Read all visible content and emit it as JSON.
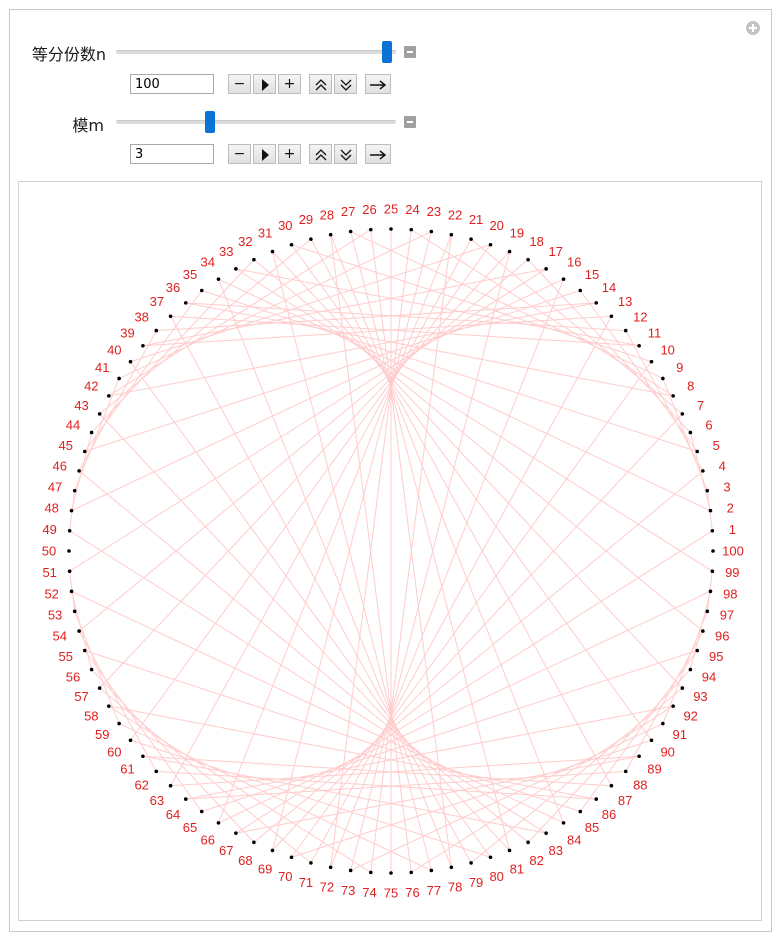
{
  "controls": {
    "n": {
      "label": "等分份数n",
      "value": "100",
      "slider_fraction": 0.985
    },
    "m": {
      "label": "模m",
      "value": "3",
      "slider_fraction": 0.33
    },
    "button_glyphs": {
      "decrement": "−",
      "increment": "+",
      "play": "play-icon",
      "faster": "double-chevron-up-icon",
      "slower": "double-chevron-down-icon",
      "direction": "arrow-right-icon"
    }
  },
  "chart_data": {
    "type": "cardioid-multiplication-circle",
    "n": 100,
    "multiplier": 3,
    "point_labels": [
      "1",
      "2",
      "3",
      "4",
      "5",
      "6",
      "7",
      "8",
      "9",
      "10",
      "11",
      "12",
      "13",
      "14",
      "15",
      "16",
      "17",
      "18",
      "19",
      "20",
      "21",
      "22",
      "23",
      "24",
      "25",
      "26",
      "27",
      "28",
      "29",
      "30",
      "31",
      "32",
      "33",
      "34",
      "35",
      "36",
      "37",
      "38",
      "39",
      "40",
      "41",
      "42",
      "43",
      "44",
      "45",
      "46",
      "47",
      "48",
      "49",
      "50",
      "51",
      "52",
      "53",
      "54",
      "55",
      "56",
      "57",
      "58",
      "59",
      "60",
      "61",
      "62",
      "63",
      "64",
      "65",
      "66",
      "67",
      "68",
      "69",
      "70",
      "71",
      "72",
      "73",
      "74",
      "75",
      "76",
      "77",
      "78",
      "79",
      "80",
      "81",
      "82",
      "83",
      "84",
      "85",
      "86",
      "87",
      "88",
      "89",
      "90",
      "91",
      "92",
      "93",
      "94",
      "95",
      "96",
      "97",
      "98",
      "99",
      "100"
    ],
    "colors": {
      "label": "#e02020",
      "point": "#000000",
      "chord": "#ffcccc"
    }
  }
}
